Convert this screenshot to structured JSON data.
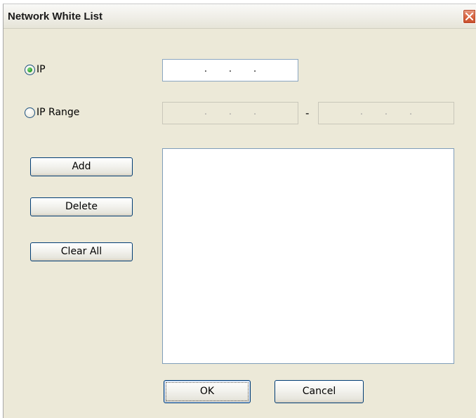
{
  "window": {
    "title": "Network White List",
    "close_icon": "close-x-icon"
  },
  "mode": {
    "selected": "IP",
    "options": [
      {
        "label": "IP",
        "selected": true
      },
      {
        "label": "IP Range",
        "selected": false
      }
    ]
  },
  "ip": {
    "dots": [
      ".",
      ".",
      "."
    ]
  },
  "range": {
    "separator": "-",
    "start_dots": [
      ".",
      ".",
      "."
    ],
    "end_dots": [
      ".",
      ".",
      "."
    ],
    "enabled": false
  },
  "actions": {
    "add_label": "Add",
    "delete_label": "Delete",
    "clear_all_label": "Clear All"
  },
  "whitelist": {
    "items": []
  },
  "footer": {
    "ok_label": "OK",
    "cancel_label": "Cancel"
  },
  "colors": {
    "dialog_bg": "#ece9d8",
    "close_button": "#d8623e",
    "radio_selected": "#2fa32f",
    "input_border": "#8aa6c1",
    "button_border": "#003c74"
  }
}
